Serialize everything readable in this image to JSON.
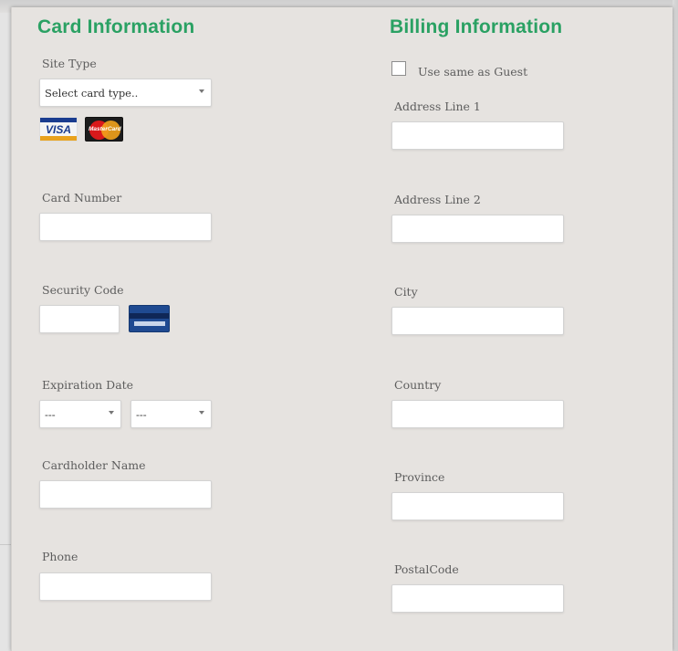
{
  "card_info": {
    "heading": "Card Information",
    "site_type_label": "Site Type",
    "site_type_value": "Select card type..",
    "card_logos": [
      "VISA",
      "MasterCard"
    ],
    "card_number_label": "Card Number",
    "card_number_value": "",
    "security_code_label": "Security Code",
    "security_code_value": "",
    "expiration_label": "Expiration Date",
    "exp_month_value": "---",
    "exp_year_value": "---",
    "cardholder_label": "Cardholder Name",
    "cardholder_value": "",
    "phone_label": "Phone",
    "phone_value": ""
  },
  "billing_info": {
    "heading": "Billing Information",
    "same_as_guest_label": "Use same as Guest",
    "same_as_guest_checked": false,
    "address1_label": "Address Line 1",
    "address1_value": "",
    "address2_label": "Address Line 2",
    "address2_value": "",
    "city_label": "City",
    "city_value": "",
    "country_label": "Country",
    "country_value": "",
    "province_label": "Province",
    "province_value": "",
    "postal_label": "PostalCode",
    "postal_value": ""
  },
  "colors": {
    "heading": "#2aa163",
    "panel_bg": "#e6e3e0",
    "label": "#5d5d5d"
  }
}
